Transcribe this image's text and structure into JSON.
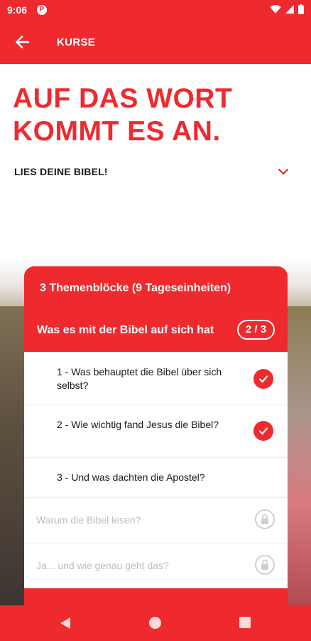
{
  "status_bar": {
    "time": "9:06",
    "app_icon_letter": "P"
  },
  "app_bar": {
    "title": "KURSE"
  },
  "hero": {
    "headline_line1": "AUF DAS WORT",
    "headline_line2": "KOMMT ES AN.",
    "subtitle": "LIES DEINE BIBEL!"
  },
  "course_card": {
    "blocks_summary": "3 Themenblöcke (9 Tageseinheiten)",
    "section_title": "Was es mit der Bibel auf sich hat",
    "progress": "2 / 3",
    "lessons": [
      {
        "label": "1 - Was behauptet die Bibel über sich selbst?",
        "status": "completed"
      },
      {
        "label": "2 - Wie wichtig fand Jesus die Bibel?",
        "status": "completed"
      },
      {
        "label": "3 - Und was dachten die Apostel?",
        "status": "open"
      }
    ],
    "locked_sections": [
      {
        "label": "Warum die Bibel lesen?",
        "status": "locked"
      },
      {
        "label": "Ja... und wie genau geht das?",
        "status": "locked"
      }
    ]
  },
  "colors": {
    "accent": "#ee2a2e",
    "text": "#1a1a1a",
    "muted": "#bdbdbd"
  }
}
